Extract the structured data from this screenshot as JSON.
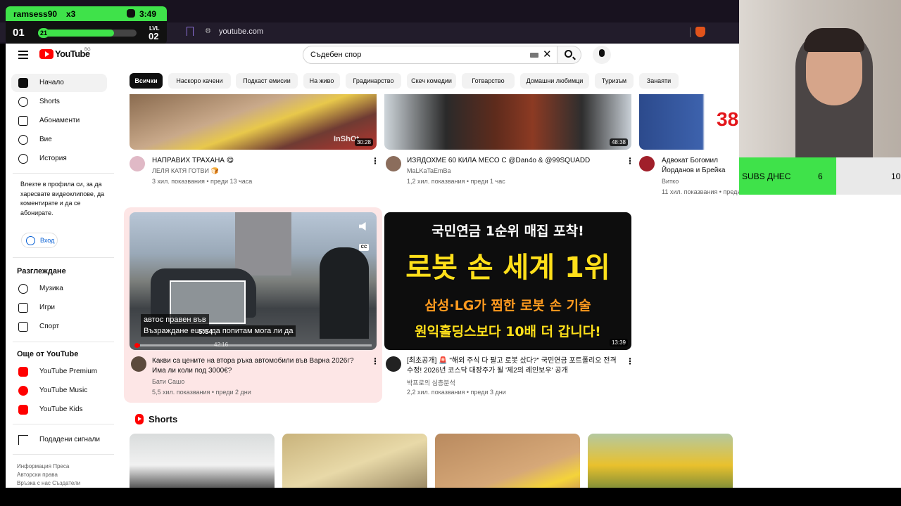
{
  "overlay": {
    "username": "ramsess90",
    "multiplier": "x3",
    "clock": "3:49",
    "left_num": "01",
    "xp_badge": "21",
    "xp_progress_pct": 77,
    "lvl_label": "LVL",
    "lvl_num": "02"
  },
  "browser": {
    "url": "youtube.com"
  },
  "header": {
    "logo_text": "YouTube",
    "region": "BG",
    "search_value": "Съдебен спор"
  },
  "sidebar": {
    "main_items": [
      "Начало",
      "Shorts",
      "Абонаменти",
      "Вие",
      "История"
    ],
    "signin_text": "Влезте в профила си, за да харесвате видеоклипове, да коментирате и да се абонирате.",
    "signin_button": "Вход",
    "explore_heading": "Разглеждане",
    "explore_items": [
      "Музика",
      "Игри",
      "Спорт"
    ],
    "more_heading": "Още от YouTube",
    "more_items": [
      "YouTube Premium",
      "YouTube Music",
      "YouTube Kids"
    ],
    "report": "Подадени сигнали",
    "footer": [
      "Информация Преса",
      "Авторски права",
      "Връзка с нас  Създатели"
    ]
  },
  "chips": [
    "Всички",
    "Наскоро качени",
    "Подкаст емисии",
    "На живо",
    "Градинарство",
    "Скеч комедии",
    "Готварство",
    "Домашни любимци",
    "Туризъм",
    "Занаяти"
  ],
  "videos_row1": [
    {
      "title": "НАПРАВИХ ТРАХАНА 😋",
      "channel": "ЛЕЛЯ КАТЯ ГОТВИ 🍞",
      "meta": "3 хил. показвания • преди 13 часа",
      "duration": "30:28",
      "watermark": "InShOt"
    },
    {
      "title": "ИЗЯДОХМЕ 60 КИЛА МЕСО С @Dan4o & @99SQUADD",
      "channel": "MaLKaTaEmBa",
      "meta": "1,2 хил. показвания • преди 1 час",
      "duration": "48:38"
    },
    {
      "title": "Адвокат Богомил Йорданов и Брейка",
      "channel": "Витко",
      "meta": "11 хил. показвания • преди",
      "badge": "38"
    }
  ],
  "videos_row2": [
    {
      "title": "Какви са цените на втора ръка автомобили във Варна 2026г? Има ли коли под 3000€?",
      "channel": "Бати Сашо",
      "meta": "5,5 хил. показвания • преди 2 дни",
      "subtitle1": "автос             правен във",
      "subtitle2": "Възраждане    ешах да попитам мога ли да",
      "preview_time": "5:54",
      "cc": "CC",
      "progress_time": "42:16"
    },
    {
      "title": "[최초공개] 🚨 \"해외 주식 다 팔고 로봇 샀다?\" 국민연금 포트폴리오 전격 수정! 2026년 코스닥 대장주가 될 '제2의 레인보우' 공개",
      "channel": "박프로의 심층분석",
      "meta": "2,2 хил. показвания • преди 3 дни",
      "duration": "13:39",
      "thumb_lines": [
        "국민연금 1순위 매집 포착!",
        "로봇 손 세계 1위",
        "삼성·LG가 찜한 로봇 손 기술",
        "원익홀딩스보다 10배 더 갑니다!"
      ]
    }
  ],
  "shorts": {
    "heading": "Shorts"
  },
  "subs_widget": {
    "label": "SUBS ДНЕС",
    "value": "6",
    "goal": "10"
  },
  "colors": {
    "accent": "#3fe24a",
    "yt_red": "#ff0000",
    "link": "#065fd4"
  }
}
